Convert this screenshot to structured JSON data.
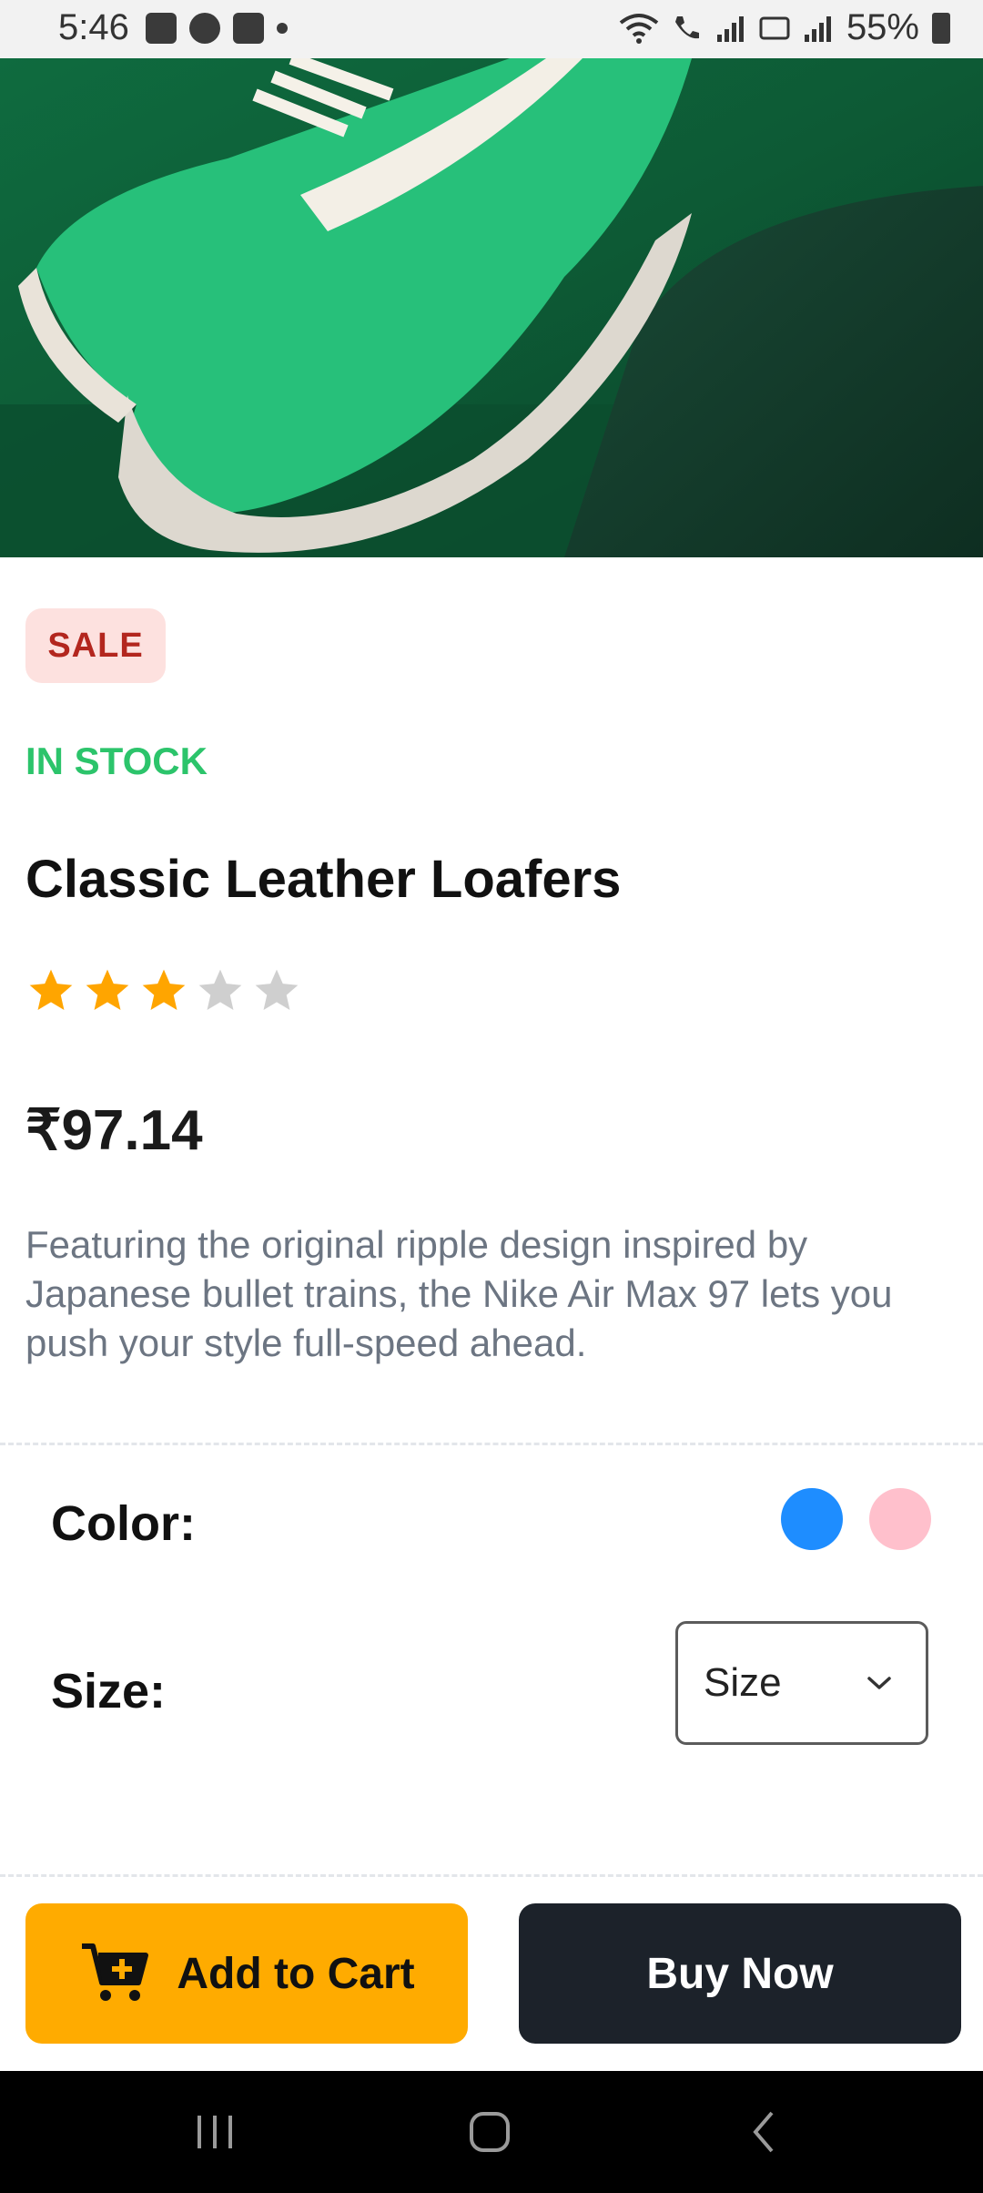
{
  "status_bar": {
    "time": "5:46",
    "battery": "55%"
  },
  "product": {
    "badge": "SALE",
    "stock": "IN STOCK",
    "title": "Classic Leather Loafers",
    "rating": 3,
    "rating_max": 5,
    "price": "₹97.14",
    "description": "Featuring the original ripple design inspired by Japanese bullet trains, the Nike Air Max 97 lets you push your style full-speed ahead."
  },
  "options": {
    "color_label": "Color:",
    "colors": [
      "#1e8dff",
      "#ffc0cc"
    ],
    "size_label": "Size:",
    "size_placeholder": "Size"
  },
  "actions": {
    "add_to_cart": "Add to Cart",
    "buy_now": "Buy Now"
  },
  "colors": {
    "accent": "#ffab00",
    "dark": "#1c222a",
    "sale": "#b3261e",
    "stock": "#2cc46b"
  }
}
